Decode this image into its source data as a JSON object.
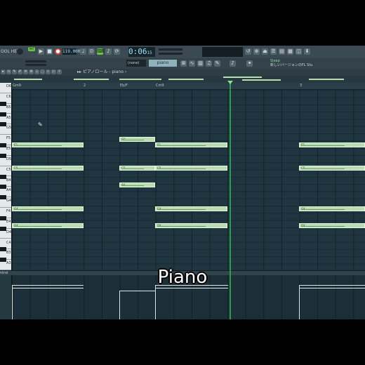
{
  "menu": {
    "left_label": "OOL HELP"
  },
  "transport": {
    "tempo": "119.000",
    "time": "0:06",
    "time_sub": "15",
    "pat_label": "PAT"
  },
  "toolbar2": {
    "snap": "(none)",
    "instrument": "piano",
    "hint_line1": "Sleep",
    "hint_line2": "新しいバージョンのFL Stu"
  },
  "pianoroll": {
    "breadcrumb": "ピアノロール - piano",
    "bar_markers": [
      "Gm9",
      "Eb/F",
      "Cm9",
      "2",
      "3"
    ],
    "key_labels": [
      "D6",
      "C6",
      "B5",
      "A5",
      "G5",
      "F5",
      "E5",
      "D5",
      "C5",
      "B4",
      "A4",
      "G4",
      "F4",
      "E4",
      "D4",
      "C4",
      "B3",
      "A3"
    ]
  },
  "lane": {
    "label": "ntrol"
  },
  "caption": "Piano",
  "colors": {
    "note": "#b7ddb1",
    "playhead": "#2fa752",
    "background": "#20343d"
  }
}
